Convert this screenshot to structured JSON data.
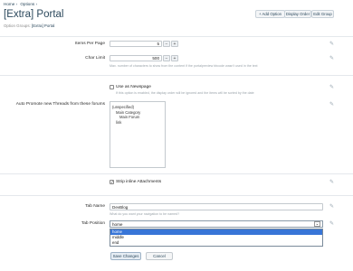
{
  "breadcrumbs": [
    "Home ›",
    "Options ›"
  ],
  "page_title": "[Extra] Portal",
  "actions": {
    "add_option": "+ Add Option",
    "display_order": "Display Order",
    "edit_group": "Edit Group"
  },
  "option_groups": {
    "label": "Option Groups:",
    "value": "[Extra] Portal"
  },
  "fields": {
    "items_per_page": {
      "label": "Items Per Page",
      "value": "5"
    },
    "char_limit": {
      "label": "Char Limit",
      "value": "500",
      "hint": "Max. number of characters to show from the content if the portalpreview bbcode wasn't used in the text"
    },
    "use_as_newspage": {
      "label": "Use as Newspage",
      "hint": "If this option is enabled, the display order will be ignored and the items will be sorted by the date"
    },
    "auto_promote": {
      "label": "Auto Promote new Threads from these forums",
      "options": [
        "(unspecified)",
        "Main Category",
        "Main Forum",
        "link"
      ]
    },
    "strip_inline": {
      "label": "Strip inline Attachments",
      "checked": true
    },
    "tab_name": {
      "label": "Tab Name",
      "value": "DevBlog",
      "hint": "What do you want your navigation to be named?"
    },
    "tab_position": {
      "label": "Tab Position",
      "value": "home",
      "options": [
        "home",
        "middle",
        "end"
      ],
      "highlighted_index": 0
    }
  },
  "buttons": {
    "save": "Save Changes",
    "cancel": "Cancel"
  }
}
